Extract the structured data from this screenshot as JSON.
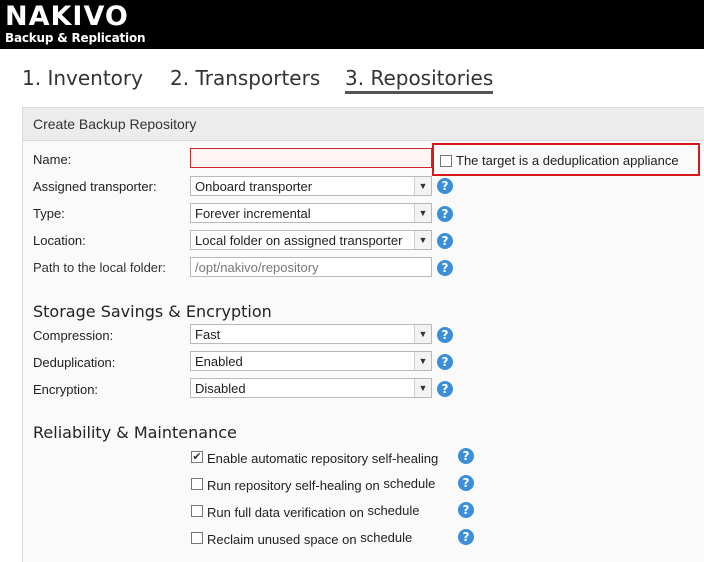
{
  "brand": {
    "name": "NAKIVO",
    "subtitle": "Backup & Replication"
  },
  "tabs": [
    {
      "label": "1. Inventory"
    },
    {
      "label": "2. Transporters"
    },
    {
      "label": "3. Repositories",
      "active": true
    }
  ],
  "panel": {
    "title": "Create Backup Repository"
  },
  "form": {
    "name_label": "Name:",
    "name_value": "",
    "dedup_appliance_label": "The target is a deduplication appliance",
    "dedup_appliance_checked": false,
    "transporter_label": "Assigned transporter:",
    "transporter_value": "Onboard transporter",
    "type_label": "Type:",
    "type_value": "Forever incremental",
    "location_label": "Location:",
    "location_value": "Local folder on assigned transporter",
    "path_label": "Path to the local folder:",
    "path_placeholder": "/opt/nakivo/repository"
  },
  "storage": {
    "title": "Storage Savings & Encryption",
    "compression_label": "Compression:",
    "compression_value": "Fast",
    "deduplication_label": "Deduplication:",
    "deduplication_value": "Enabled",
    "encryption_label": "Encryption:",
    "encryption_value": "Disabled"
  },
  "reliability": {
    "title": "Reliability & Maintenance",
    "items": [
      {
        "label": "Enable automatic repository self-healing",
        "tail": "",
        "checked": true
      },
      {
        "label": "Run repository self-healing on",
        "tail": "schedule",
        "checked": false
      },
      {
        "label": "Run full data verification on",
        "tail": "schedule",
        "checked": false
      },
      {
        "label": "Reclaim unused space on",
        "tail": "schedule",
        "checked": false
      }
    ]
  },
  "icons": {
    "help": "?",
    "dropdown": "▼",
    "check": "✔"
  },
  "colors": {
    "accent_blue": "#3b8fd8",
    "highlight_red": "#d9181e"
  }
}
